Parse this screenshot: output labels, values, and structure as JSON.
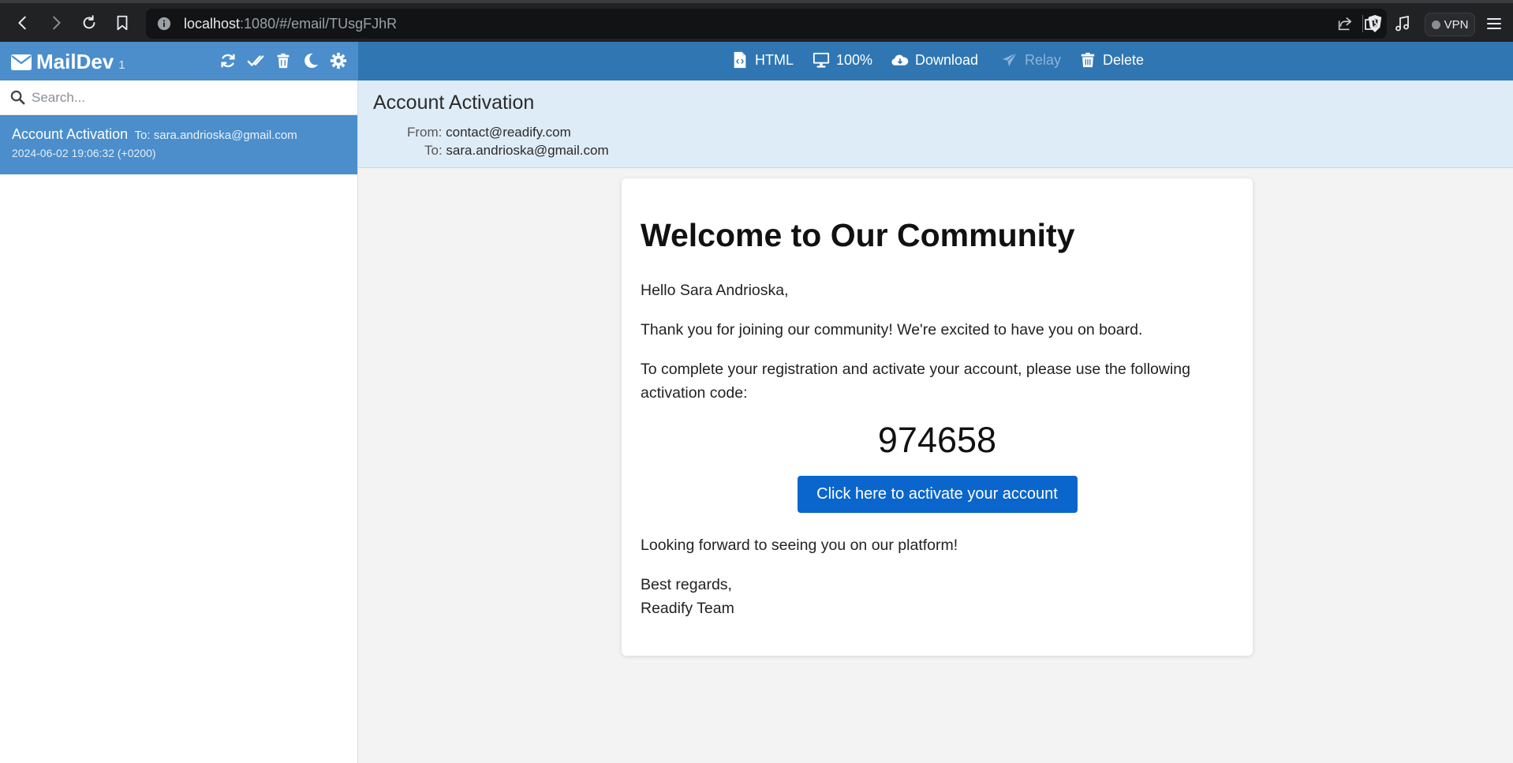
{
  "browser": {
    "url_host": "localhost",
    "url_path": ":1080/#/email/TUsgFJhR",
    "vpn_label": "VPN"
  },
  "app": {
    "name": "MailDev",
    "count": "1"
  },
  "toolbar": {
    "html_label": "HTML",
    "zoom_label": "100%",
    "download_label": "Download",
    "relay_label": "Relay",
    "delete_label": "Delete"
  },
  "search": {
    "placeholder": "Search..."
  },
  "mail_list": [
    {
      "subject": "Account Activation",
      "to": "To: sara.andrioska@gmail.com",
      "date": "2024-06-02 19:06:32 (+0200)"
    }
  ],
  "message": {
    "subject": "Account Activation",
    "from_label": "From:",
    "from_value": "contact@readify.com",
    "to_label": "To:",
    "to_value": "sara.andrioska@gmail.com"
  },
  "email_body": {
    "title": "Welcome to Our Community",
    "greeting": "Hello Sara Andrioska,",
    "intro": "Thank you for joining our community! We're excited to have you on board.",
    "instructions": "To complete your registration and activate your account, please use the following activation code:",
    "code": "974658",
    "button_label": "Click here to activate your account",
    "closing": "Looking forward to seeing you on our platform!",
    "signoff": "Best regards,",
    "signature": "Readify Team"
  },
  "colors": {
    "sidebar_header": "#4b8ecb",
    "main_header": "#2f76b3",
    "selected_item": "#4b8ecb",
    "activate_button": "#0a66cc"
  }
}
